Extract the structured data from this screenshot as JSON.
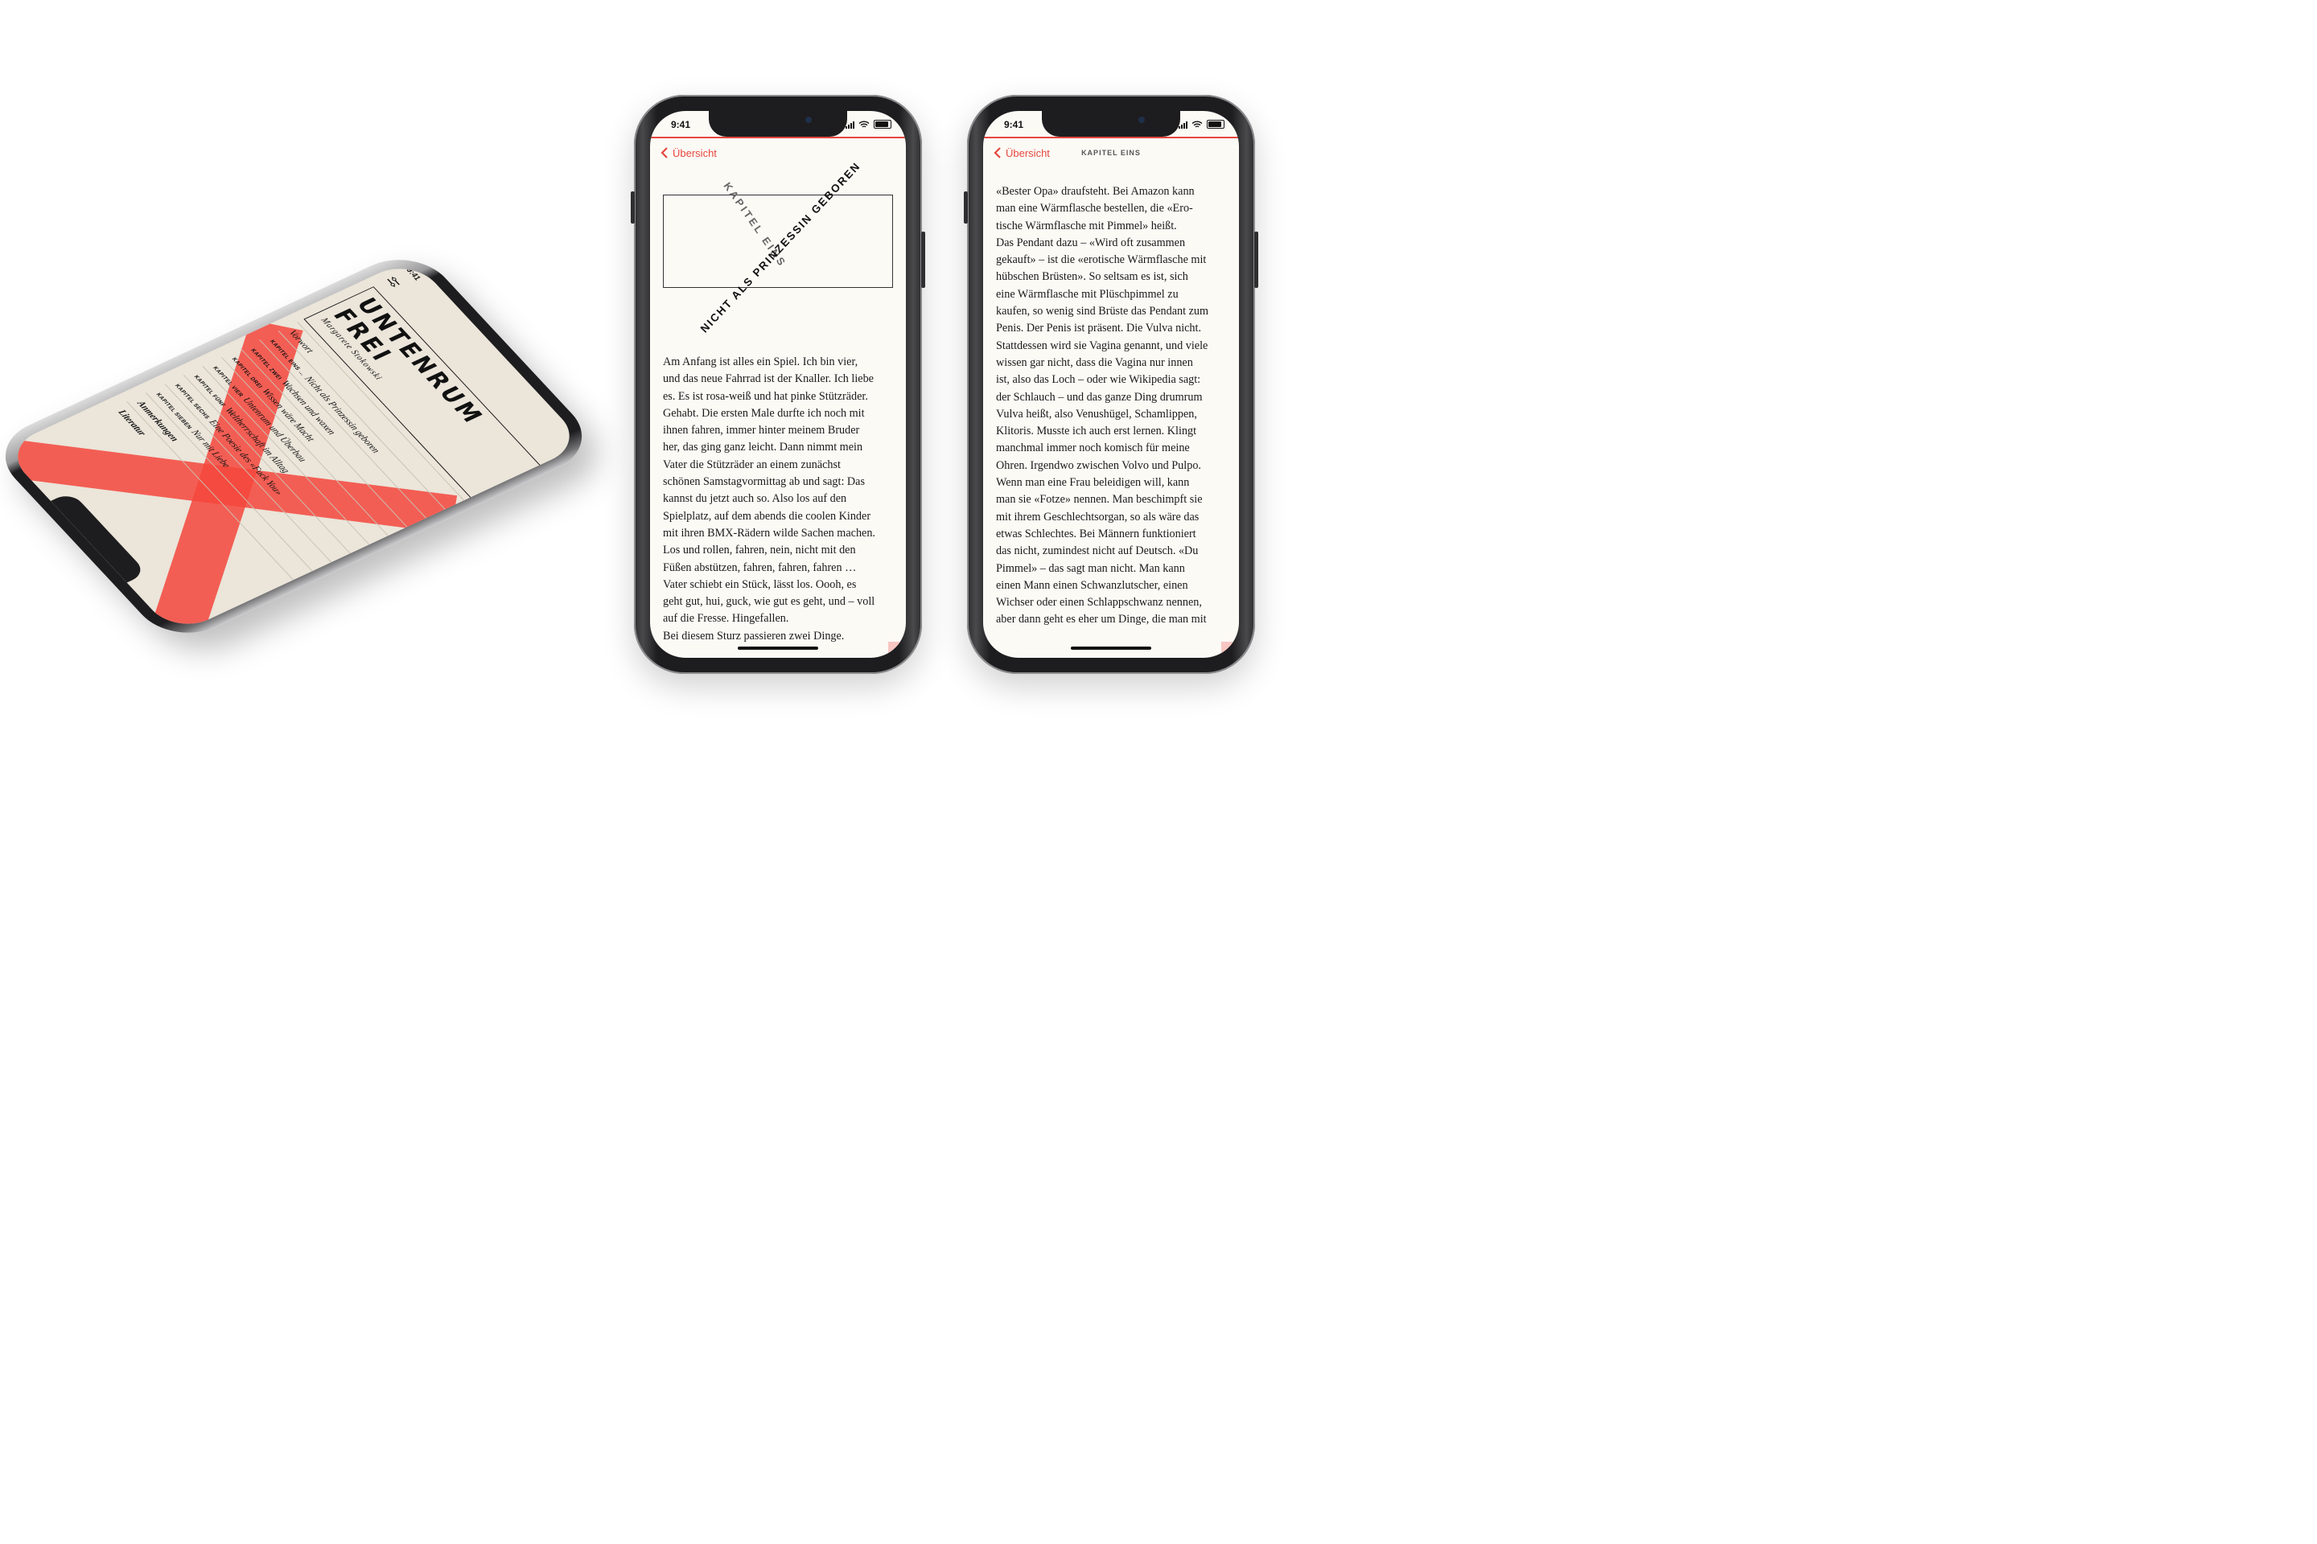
{
  "colors": {
    "accent": "#e6463f",
    "paper": "#fcfaf5"
  },
  "status_bar": {
    "time": "9:41"
  },
  "tilted_phone": {
    "time": "9:41",
    "info_icon": "i",
    "title_line1": "UNTENRUM",
    "title_line2": "FREI",
    "author": "Margarete Stokowski",
    "resume_label": "Weiterlesen",
    "toc": [
      {
        "kapitel": "",
        "title": "Vorwort"
      },
      {
        "kapitel": "KAPITEL EINS …",
        "title": "Nicht als Prinzessin geboren"
      },
      {
        "kapitel": "KAPITEL ZWEI",
        "title": "Wachsen und waxen"
      },
      {
        "kapitel": "KAPITEL DREI",
        "title": "Wissen wäre Macht"
      },
      {
        "kapitel": "KAPITEL VIER",
        "title": "Untenrum und Überbau"
      },
      {
        "kapitel": "KAPITEL FÜNF",
        "title": "Weltherrschaft im Alltag"
      },
      {
        "kapitel": "KAPITEL SECHS",
        "title": "Eine Poesie des «Fuck You»"
      },
      {
        "kapitel": "KAPITEL SIEBEN",
        "title": "Nur mit Liebe"
      },
      {
        "kapitel": "",
        "title": "Anmerkungen"
      },
      {
        "kapitel": "",
        "title": "Literatur"
      }
    ]
  },
  "middle_phone": {
    "back_label": "Übersicht",
    "x_grey": "KAPITEL EINS",
    "x_black": "NICHT ALS PRINZESSIN GEBOREN",
    "lines": [
      "Am Anfang ist alles ein Spiel. Ich bin vier,",
      "und das neue Fahrrad ist der Knaller. Ich liebe",
      "es. Es ist rosa-weiß und hat pinke Stützräder.",
      "Gehabt. Die ersten Male durfte ich noch mit",
      "ihnen fahren, immer hinter meinem Bruder",
      "her, das ging ganz leicht. Dann nimmt mein",
      "Vater die Stützräder an einem zunächst",
      "schönen Samstagvormittag ab und sagt: Das",
      "kannst du jetzt auch so. Also los auf den",
      "Spielplatz, auf dem abends die coolen Kinder",
      "mit ihren BMX-Rädern wilde Sachen machen.",
      "Los und rollen, fahren, nein, nicht mit den",
      "Füßen abstützen, fahren, fahren, fahren …",
      "Vater schiebt ein Stück, lässt los. Oooh, es",
      "geht gut, hui, guck, wie gut es geht, und – voll",
      "auf die Fresse. Hingefallen.",
      "Bei diesem Sturz passieren zwei Dinge."
    ]
  },
  "right_phone": {
    "back_label": "Übersicht",
    "nav_title": "KAPITEL EINS",
    "lines": [
      "«Bester Opa» draufsteht. Bei Amazon kann",
      "man eine Wärmflasche bestellen, die «Ero-",
      "tische Wärmflasche mit Pimmel» heißt.",
      "Das Pendant dazu – «Wird oft zusammen",
      "gekauft» – ist die «erotische Wärmflasche mit",
      "hübschen Brüsten». So seltsam es ist, sich",
      "eine Wärmflasche mit Plüschpimmel zu",
      "kaufen, so wenig sind Brüste das Pendant zum",
      "Penis. Der Penis ist präsent. Die Vulva nicht.",
      "Stattdessen wird sie Vagina genannt, und viele",
      "wissen gar nicht, dass die Vagina nur innen",
      "ist, also das Loch – oder wie Wikipedia sagt:",
      "der Schlauch – und das ganze Ding drumrum",
      "Vulva heißt, also Venushügel, Schamlippen,",
      "Klitoris. Musste ich auch erst lernen. Klingt",
      "manchmal immer noch komisch für meine",
      "Ohren. Irgendwo zwischen Volvo und Pulpo.",
      "Wenn man eine Frau beleidigen will, kann",
      "man sie «Fotze» nennen. Man beschimpft sie",
      "mit ihrem Geschlechtsorgan, so als wäre das",
      "etwas Schlechtes. Bei Männern funktioniert",
      "das nicht, zumindest nicht auf Deutsch. «Du",
      "Pimmel» – das sagt man nicht. Man kann",
      "einen Mann einen Schwanzlutscher, einen",
      "Wichser oder einen Schlappschwanz nennen,",
      "aber dann geht es eher um Dinge, die man mit"
    ]
  }
}
